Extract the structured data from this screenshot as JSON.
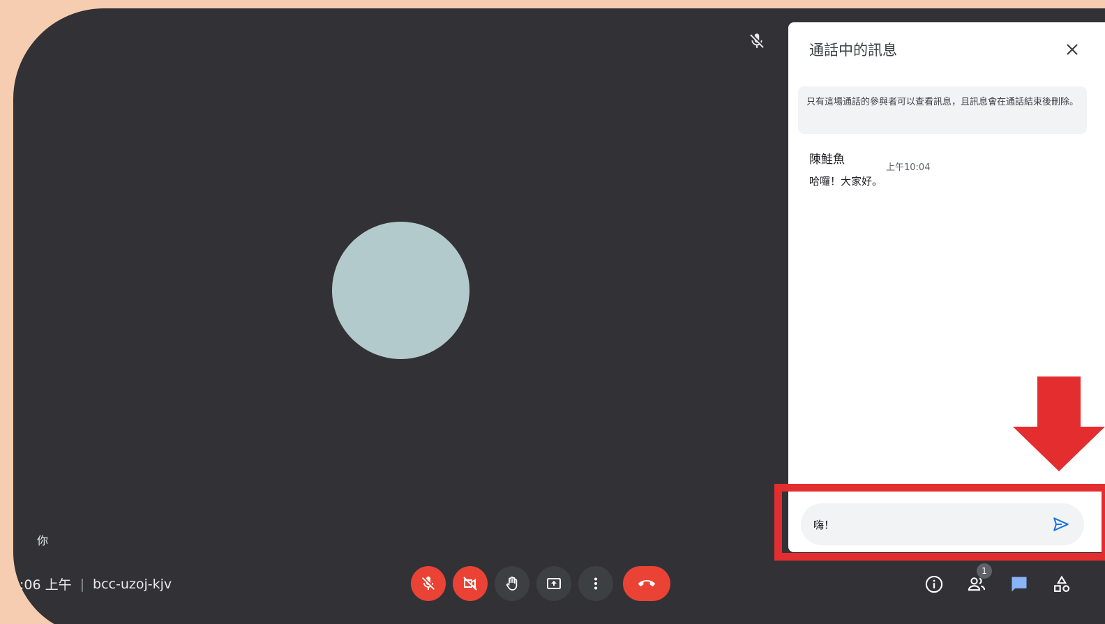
{
  "meeting": {
    "time": ":06 上午",
    "separator": "|",
    "code": "bcc-uzoj-kjv",
    "self_label": "你"
  },
  "controls": [
    {
      "name": "mic-off-button",
      "icon": "mic-off-icon",
      "state": "off"
    },
    {
      "name": "camera-off-button",
      "icon": "camera-off-icon",
      "state": "off"
    },
    {
      "name": "raise-hand-button",
      "icon": "hand-icon"
    },
    {
      "name": "present-button",
      "icon": "present-screen-icon"
    },
    {
      "name": "more-options-button",
      "icon": "more-vert-icon"
    },
    {
      "name": "leave-call-button",
      "icon": "call-end-icon"
    }
  ],
  "right_icons": {
    "info": "info-icon",
    "people": "people-icon",
    "people_count": "1",
    "chat": "chat-icon",
    "activities": "activities-icon"
  },
  "chat": {
    "title": "通話中的訊息",
    "notice": "只有這場通話的參與者可以查看訊息，且訊息會在通話結束後刪除。",
    "messages": [
      {
        "sender": "陳鮭魚",
        "time": "上午10:04",
        "text": "哈囉！大家好。"
      }
    ],
    "input_value": "嗨！"
  },
  "colors": {
    "background": "#f6cdb0",
    "stage": "#323236",
    "danger": "#ea4335",
    "accent": "#1a73e8",
    "annotation": "#e32d2f"
  }
}
